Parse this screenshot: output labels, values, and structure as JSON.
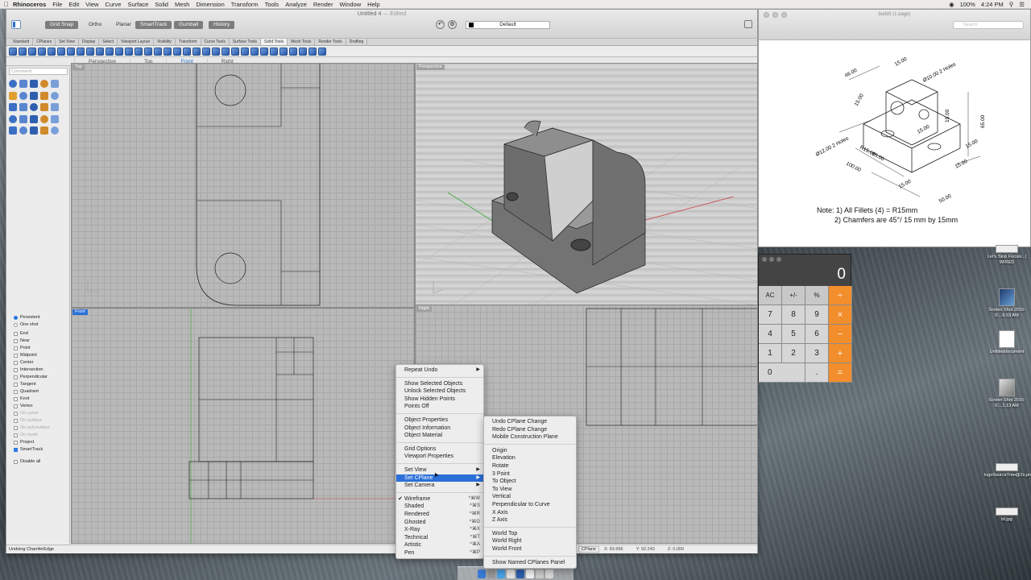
{
  "menubar": {
    "app": "Rhinoceros",
    "items": [
      "File",
      "Edit",
      "View",
      "Curve",
      "Surface",
      "Solid",
      "Mesh",
      "Dimension",
      "Transform",
      "Tools",
      "Analyze",
      "Render",
      "Window",
      "Help"
    ],
    "clock": "4:24 PM",
    "battery": "100%"
  },
  "rhino": {
    "title": "Untitled 4",
    "edited": "— Edited",
    "modes": [
      "Grid Snap",
      "Ortho",
      "Planar",
      "SmartTrack",
      "Gumball",
      "History"
    ],
    "layer": "Default",
    "toolbar_tabs": [
      "Standard",
      "CPlanes",
      "Set View",
      "Display",
      "Select",
      "Viewport Layout",
      "Visibility",
      "Transform",
      "Curve Tools",
      "Surface Tools",
      "Solid Tools",
      "Mesh Tools",
      "Render Tools",
      "Drafting"
    ],
    "viewport_tabs": [
      "Perspective",
      "Top",
      "Front",
      "Right"
    ],
    "command_placeholder": "Command",
    "viewports": {
      "top": "Top",
      "perspective": "Perspective",
      "front": "Front",
      "right": "Right"
    },
    "osnaps": [
      {
        "label": "Persistent",
        "kind": "radio",
        "on": true
      },
      {
        "label": "One shot",
        "kind": "radio",
        "on": false
      },
      {
        "label": "End",
        "kind": "box",
        "on": false
      },
      {
        "label": "Near",
        "kind": "box",
        "on": false
      },
      {
        "label": "Point",
        "kind": "box",
        "on": false
      },
      {
        "label": "Midpoint",
        "kind": "box",
        "on": false
      },
      {
        "label": "Center",
        "kind": "box",
        "on": false
      },
      {
        "label": "Intersection",
        "kind": "box",
        "on": false
      },
      {
        "label": "Perpendicular",
        "kind": "box",
        "on": false
      },
      {
        "label": "Tangent",
        "kind": "box",
        "on": false
      },
      {
        "label": "Quadrant",
        "kind": "box",
        "on": false
      },
      {
        "label": "Knot",
        "kind": "box",
        "on": false
      },
      {
        "label": "Vertex",
        "kind": "box",
        "on": false
      },
      {
        "label": "On curve",
        "kind": "box",
        "on": false,
        "disabled": true
      },
      {
        "label": "On surface",
        "kind": "box",
        "on": false,
        "disabled": true
      },
      {
        "label": "On polysurface",
        "kind": "box",
        "on": false,
        "disabled": true
      },
      {
        "label": "On mesh",
        "kind": "box",
        "on": false,
        "disabled": true
      },
      {
        "label": "Project",
        "kind": "box",
        "on": false
      },
      {
        "label": "SmartTrack",
        "kind": "box",
        "on": true
      }
    ],
    "disable_all": "Disable all",
    "status": {
      "message": "Undoing ChamferEdge",
      "cplane": "CPlane",
      "x": "X: 83.956",
      "y": "Y: 92.243",
      "z": "Z: 0.000"
    }
  },
  "context_menu": {
    "groups": [
      [
        {
          "label": "Repeat Undo",
          "submenu": true
        }
      ],
      [
        {
          "label": "Show Selected Objects"
        },
        {
          "label": "Unlock Selected Objects"
        },
        {
          "label": "Show Hidden Points"
        },
        {
          "label": "Points Off"
        }
      ],
      [
        {
          "label": "Object Properties"
        },
        {
          "label": "Object Information"
        },
        {
          "label": "Object Material"
        }
      ],
      [
        {
          "label": "Grid Options"
        },
        {
          "label": "Viewport Properties"
        }
      ],
      [
        {
          "label": "Set View",
          "submenu": true
        },
        {
          "label": "Set CPlane",
          "submenu": true,
          "highlight": true
        },
        {
          "label": "Set Camera",
          "submenu": true
        }
      ],
      [
        {
          "label": "Wireframe",
          "shortcut": "^⌘W",
          "checked": true
        },
        {
          "label": "Shaded",
          "shortcut": "^⌘S"
        },
        {
          "label": "Rendered",
          "shortcut": "^⌘R"
        },
        {
          "label": "Ghosted",
          "shortcut": "^⌘G"
        },
        {
          "label": "X-Ray",
          "shortcut": "^⌘X"
        },
        {
          "label": "Technical",
          "shortcut": "^⌘T"
        },
        {
          "label": "Artistic",
          "shortcut": "^⌘A"
        },
        {
          "label": "Pen",
          "shortcut": "^⌘P"
        }
      ]
    ]
  },
  "cplane_submenu": {
    "groups": [
      [
        "Undo CPlane Change",
        "Redo CPlane Change",
        "Mobile Construction Plane"
      ],
      [
        "Origin",
        "Elevation",
        "Rotate",
        "3 Point",
        "To Object",
        "To View",
        "Vertical",
        "Perpendicular to Curve",
        "X Axis",
        "Z Axis"
      ],
      [
        "World Top",
        "World Right",
        "World Front"
      ],
      [
        "Show Named CPlanes Panel"
      ]
    ]
  },
  "preview": {
    "title": "build3 (1 page)",
    "search_placeholder": "Search",
    "note_line1": "Note: 1) All Fillets (4) = R15mm",
    "note_line2": "2) Chamfers are 45°/ 15 mm by 15mm",
    "dims": [
      "46.00",
      "15.00",
      "Ø10.00 2 Holes",
      "15.00",
      "15.00",
      "15.00",
      "65.00",
      "Ø12.00 2 Holes",
      "R15.00",
      "15.00",
      "100.00",
      "15.00",
      "15.00",
      "50.00",
      "15.00"
    ]
  },
  "calculator": {
    "display": "0",
    "keys": [
      {
        "label": "AC",
        "kind": "fn"
      },
      {
        "label": "+/-",
        "kind": "fn"
      },
      {
        "label": "%",
        "kind": "fn"
      },
      {
        "label": "÷",
        "kind": "op"
      },
      {
        "label": "7"
      },
      {
        "label": "8"
      },
      {
        "label": "9"
      },
      {
        "label": "×",
        "kind": "op"
      },
      {
        "label": "4"
      },
      {
        "label": "5"
      },
      {
        "label": "6"
      },
      {
        "label": "−",
        "kind": "op"
      },
      {
        "label": "1"
      },
      {
        "label": "2"
      },
      {
        "label": "3"
      },
      {
        "label": "+",
        "kind": "op"
      },
      {
        "label": "0",
        "wide": true
      },
      {
        "label": "."
      },
      {
        "label": "=",
        "kind": "op"
      }
    ]
  },
  "desktop_icons": [
    {
      "label": "Let's Stop Focusi...| WIRED",
      "style": "wide"
    },
    {
      "label": "Screen Shot 2016-0....6.53 AM",
      "style": "dark"
    },
    {
      "label": "Untitleddocument",
      "style": ""
    },
    {
      "label": "Screen Shot 2016-0....1.13 AM",
      "style": "photo"
    },
    {
      "label": "logoSourceTree@2x.png",
      "style": "wide"
    },
    {
      "label": "bt.jpg",
      "style": "wide"
    }
  ]
}
